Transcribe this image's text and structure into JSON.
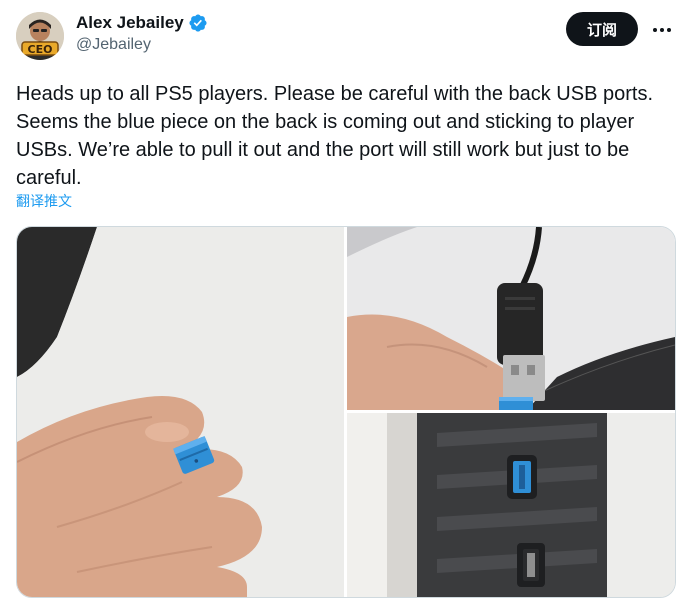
{
  "author": {
    "display_name": "Alex Jebailey",
    "handle": "@Jebailey",
    "avatar_badge": "CEO",
    "verified": true
  },
  "actions": {
    "subscribe_label": "订阅",
    "more_icon": "more-horizontal-icon"
  },
  "tweet": {
    "text": "Heads up to all PS5 players. Please be careful with the back USB ports. Seems the blue piece on the back is coming out and sticking to player USBs. We’re able to pull it out and the port will still work but just to be careful.",
    "translate_label": "翻译推文"
  },
  "colors": {
    "verified_blue": "#1d9bf0",
    "subscribe_bg": "#0f1419",
    "usb_blue": "#2f8fd6",
    "link_blue": "#1d9bf0"
  }
}
